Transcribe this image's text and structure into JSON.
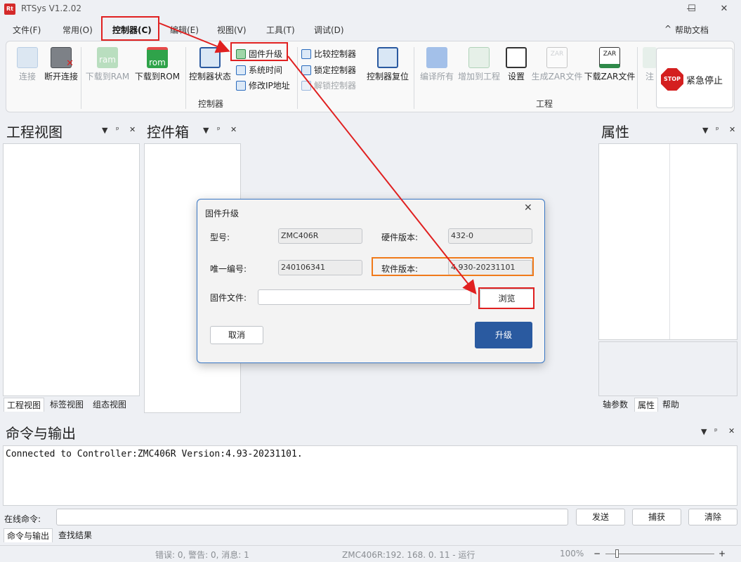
{
  "app": {
    "title": "RTSys V1.2.02",
    "logo_text": "Rt"
  },
  "window_controls": {
    "minimize": "—",
    "maximize": "☐",
    "close": "✕"
  },
  "menu": {
    "items": [
      "文件(F)",
      "常用(O)",
      "控制器(C)",
      "编辑(E)",
      "视图(V)",
      "工具(T)",
      "调试(D)"
    ],
    "help": "帮助文档",
    "collapse": "^"
  },
  "ribbon": {
    "connect": "连接",
    "disconnect": "断开连接",
    "download_ram": "下载到RAM",
    "download_rom": "下载到ROM",
    "ram_icon": "ram",
    "rom_icon": "rom",
    "controller_status": "控制器状态",
    "firmware_upgrade": "固件升级",
    "system_time": "系统时间",
    "modify_ip": "修改IP地址",
    "compare_controller": "比较控制器",
    "lock_controller": "锁定控制器",
    "unlock_controller": "解锁控制器",
    "controller_reset": "控制器复位",
    "group_controller": "控制器",
    "compile_all": "编译所有",
    "add_to_project": "增加到工程",
    "settings": "设置",
    "generate_zar": "生成ZAR文件",
    "download_zar": "下载ZAR文件",
    "zar_icon": "ZAR",
    "annotate": "注",
    "group_project": "工程",
    "emergency_stop": "紧急停止",
    "stop_icon": "STOP"
  },
  "panels": {
    "project_view": {
      "title": "工程视图",
      "tabs": [
        "工程视图",
        "标签视图",
        "组态视图"
      ]
    },
    "toolbox": {
      "title": "控件箱"
    },
    "properties": {
      "title": "属性",
      "tabs": [
        "轴参数",
        "属性",
        "帮助"
      ]
    },
    "controls": {
      "dropdown": "▼",
      "pin": "ᵖ",
      "close": "✕"
    }
  },
  "dialog": {
    "title": "固件升级",
    "close": "✕",
    "model_label": "型号:",
    "model_value": "ZMC406R",
    "hw_label": "硬件版本:",
    "hw_value": "432-0",
    "uid_label": "唯一编号:",
    "uid_value": "240106341",
    "sw_label": "软件版本:",
    "sw_value": "4.930-20231101",
    "file_label": "固件文件:",
    "file_value": "",
    "browse": "浏览",
    "cancel": "取消",
    "upgrade": "升级"
  },
  "output": {
    "title": "命令与输出",
    "text": "Connected to Controller:ZMC406R Version:4.93-20231101.",
    "online_cmd_label": "在线命令:",
    "send": "发送",
    "capture": "捕获",
    "clear": "清除",
    "tabs": [
      "命令与输出",
      "查找结果"
    ]
  },
  "statusbar": {
    "messages": "错误: 0, 警告: 0, 消息: 1",
    "connection": "ZMC406R:192. 168. 0. 11 - 运行",
    "zoom": "100%",
    "zoom_minus": "−",
    "zoom_plus": "+"
  },
  "colors": {
    "accent": "#2a5aa0",
    "annotation_red": "#e02020",
    "annotation_orange": "#f07a1a"
  }
}
